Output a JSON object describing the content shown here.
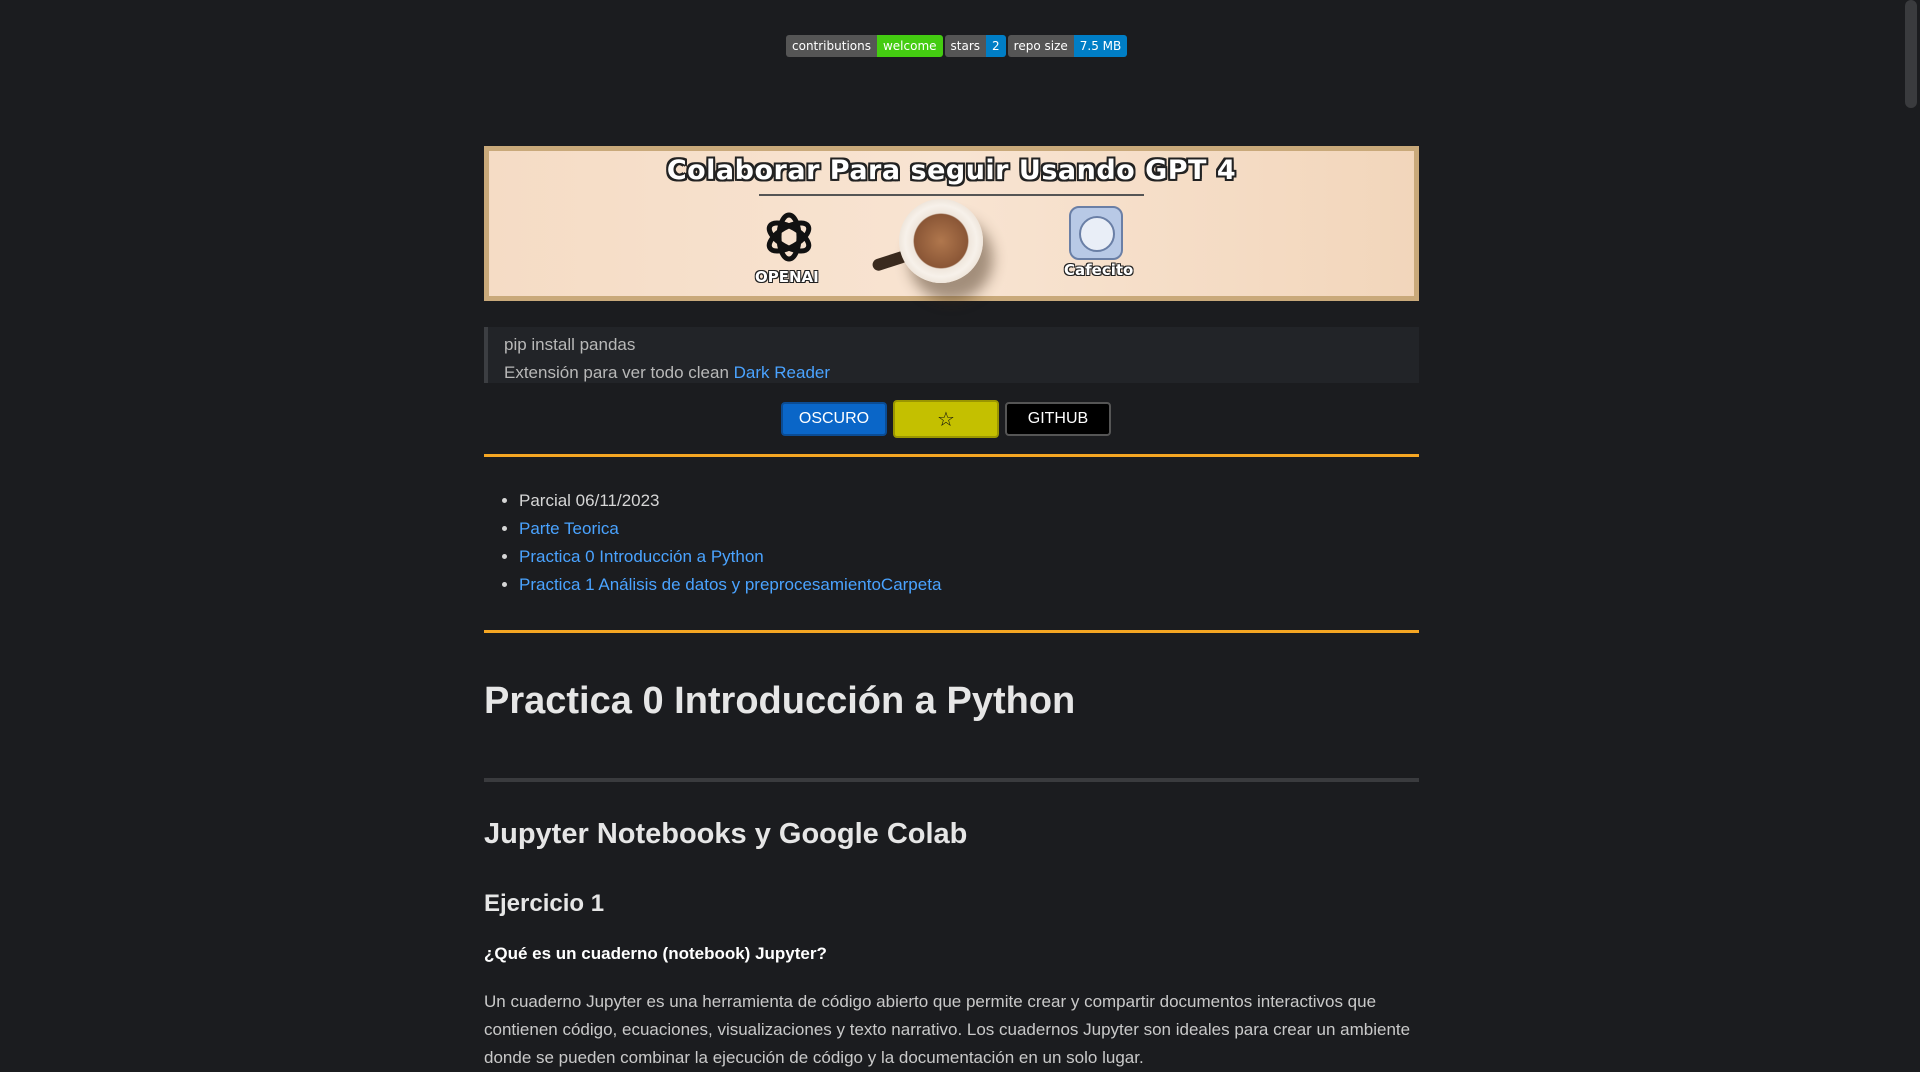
{
  "badges": [
    {
      "key": "contributions",
      "value": "welcome",
      "color": "#44cc11"
    },
    {
      "key": "stars",
      "value": "2",
      "color": "#007ec6"
    },
    {
      "key": "repo size",
      "value": "7.5 MB",
      "color": "#007ec6"
    }
  ],
  "banner": {
    "title": "Colaborar Para seguir Usando GPT 4",
    "openai_label": "OPENAI",
    "cafecito_label": "Cafecito"
  },
  "quote": {
    "line1": "pip install pandas",
    "line2_prefix": "Extensión para ver todo clean ",
    "link": "Dark Reader"
  },
  "buttons": {
    "dark": "OSCURO",
    "star": "☆",
    "github": "GITHUB"
  },
  "toc": {
    "item0": "Parcial 06/11/2023",
    "item1": "Parte Teorica",
    "item2": "Practica 0 Introducción a Python",
    "item3": "Practica 1 Análisis de datos y preprocesamientoCarpeta"
  },
  "main": {
    "title": "Practica 0 Introducción a Python",
    "section": "Jupyter Notebooks y Google Colab",
    "exercise": "Ejercicio 1",
    "question": "¿Qué es un cuaderno (notebook) Jupyter?",
    "paragraph": "Un cuaderno Jupyter es una herramienta de código abierto que permite crear y compartir documentos interactivos que contienen código, ecuaciones, visualizaciones y texto narrativo. Los cuadernos Jupyter son ideales para crear un ambiente donde se pueden combinar la ejecución de código y la documentación en un solo lugar."
  },
  "colors": {
    "background": "#1b1c1f",
    "accent_orange": "#f5a623",
    "link_blue": "#4aa3ff",
    "button_blue": "#0a66c8",
    "button_yellow": "#c4c000"
  }
}
